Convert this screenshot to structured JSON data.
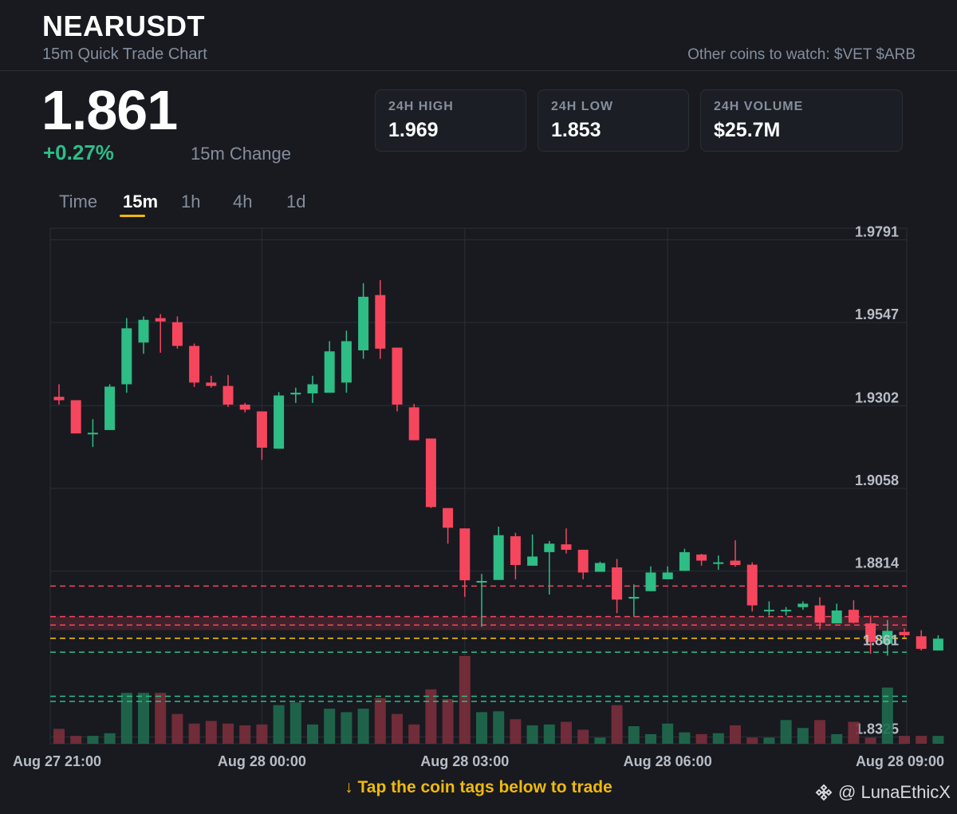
{
  "header": {
    "symbol": "NEARUSDT",
    "subtitle": "15m Quick Trade Chart",
    "watch_text": "Other coins to watch: $VET $ARB"
  },
  "price": {
    "last": "1.861",
    "change_pct": "+0.27%",
    "change_label": "15m Change"
  },
  "stats": [
    {
      "label": "24H HIGH",
      "value": "1.969"
    },
    {
      "label": "24H LOW",
      "value": "1.853"
    },
    {
      "label": "24H VOLUME",
      "value": "$25.7M"
    }
  ],
  "timeframes": {
    "items": [
      "Time",
      "15m",
      "1h",
      "4h",
      "1d"
    ],
    "active": "15m"
  },
  "chart_data": {
    "type": "candlestick",
    "y_ticks": [
      "1.9791",
      "1.9547",
      "1.9302",
      "1.9058",
      "1.8814",
      "1.8325"
    ],
    "ylim": [
      1.8305,
      1.9825
    ],
    "x_ticks": [
      "Aug 27 21:00",
      "Aug 28 00:00",
      "Aug 28 03:00",
      "Aug 28 06:00",
      "Aug 28 09:00"
    ],
    "x_tick_candle_index": [
      0,
      12,
      24,
      36,
      48
    ],
    "current_price_label": "1.861",
    "levels": [
      {
        "value": 1.877,
        "style": "dashed",
        "color": "#f6465d"
      },
      {
        "value": 1.868,
        "style": "dashed",
        "color": "#f6465d"
      },
      {
        "value": 1.8655,
        "style": "dashed",
        "color": "#f6465d"
      },
      {
        "value": 1.868,
        "style": "band",
        "color": "#f6465d",
        "band_to": 1.864
      },
      {
        "value": 1.8616,
        "style": "dashed",
        "color": "#f0b90b"
      },
      {
        "value": 1.8575,
        "style": "dashed",
        "color": "#2ebd85"
      },
      {
        "value": 1.8445,
        "style": "dashed",
        "color": "#2ebd85"
      },
      {
        "value": 1.843,
        "style": "dashed",
        "color": "#2ebd85"
      }
    ],
    "candles": [
      {
        "o": 1.9328,
        "h": 1.9365,
        "l": 1.9305,
        "c": 1.9318
      },
      {
        "o": 1.9318,
        "h": 1.9318,
        "l": 1.922,
        "c": 1.922
      },
      {
        "o": 1.9222,
        "h": 1.9262,
        "l": 1.918,
        "c": 1.9222
      },
      {
        "o": 1.923,
        "h": 1.9365,
        "l": 1.923,
        "c": 1.9358
      },
      {
        "o": 1.9365,
        "h": 1.956,
        "l": 1.934,
        "c": 1.953
      },
      {
        "o": 1.9488,
        "h": 1.9565,
        "l": 1.9455,
        "c": 1.9555
      },
      {
        "o": 1.956,
        "h": 1.9572,
        "l": 1.9458,
        "c": 1.955
      },
      {
        "o": 1.9548,
        "h": 1.9565,
        "l": 1.947,
        "c": 1.9478
      },
      {
        "o": 1.9478,
        "h": 1.9485,
        "l": 1.9357,
        "c": 1.937
      },
      {
        "o": 1.937,
        "h": 1.939,
        "l": 1.9355,
        "c": 1.936
      },
      {
        "o": 1.936,
        "h": 1.9392,
        "l": 1.9298,
        "c": 1.9305
      },
      {
        "o": 1.9305,
        "h": 1.931,
        "l": 1.9282,
        "c": 1.929
      },
      {
        "o": 1.9285,
        "h": 1.9285,
        "l": 1.9142,
        "c": 1.9178
      },
      {
        "o": 1.9175,
        "h": 1.9342,
        "l": 1.9175,
        "c": 1.9332
      },
      {
        "o": 1.9335,
        "h": 1.9355,
        "l": 1.931,
        "c": 1.934
      },
      {
        "o": 1.9338,
        "h": 1.939,
        "l": 1.931,
        "c": 1.9365
      },
      {
        "o": 1.934,
        "h": 1.9492,
        "l": 1.934,
        "c": 1.9462
      },
      {
        "o": 1.937,
        "h": 1.9523,
        "l": 1.934,
        "c": 1.9492
      },
      {
        "o": 1.9465,
        "h": 1.9663,
        "l": 1.944,
        "c": 1.9623
      },
      {
        "o": 1.9628,
        "h": 1.9672,
        "l": 1.944,
        "c": 1.947
      },
      {
        "o": 1.9473,
        "h": 1.9473,
        "l": 1.9285,
        "c": 1.9305
      },
      {
        "o": 1.9297,
        "h": 1.9307,
        "l": 1.92,
        "c": 1.92
      },
      {
        "o": 1.9205,
        "h": 1.9205,
        "l": 1.9,
        "c": 1.9003
      },
      {
        "o": 1.9,
        "h": 1.9,
        "l": 1.8895,
        "c": 1.8942
      },
      {
        "o": 1.894,
        "h": 1.894,
        "l": 1.8738,
        "c": 1.8787
      },
      {
        "o": 1.8782,
        "h": 1.8806,
        "l": 1.865,
        "c": 1.8785
      },
      {
        "o": 1.8788,
        "h": 1.8945,
        "l": 1.8788,
        "c": 1.892
      },
      {
        "o": 1.8917,
        "h": 1.8927,
        "l": 1.879,
        "c": 1.8832
      },
      {
        "o": 1.883,
        "h": 1.8922,
        "l": 1.883,
        "c": 1.8857
      },
      {
        "o": 1.887,
        "h": 1.8903,
        "l": 1.8745,
        "c": 1.8895
      },
      {
        "o": 1.8893,
        "h": 1.894,
        "l": 1.8866,
        "c": 1.8877
      },
      {
        "o": 1.8877,
        "h": 1.8877,
        "l": 1.879,
        "c": 1.881
      },
      {
        "o": 1.8812,
        "h": 1.8842,
        "l": 1.8812,
        "c": 1.8838
      },
      {
        "o": 1.8825,
        "h": 1.885,
        "l": 1.869,
        "c": 1.873
      },
      {
        "o": 1.8733,
        "h": 1.8775,
        "l": 1.868,
        "c": 1.8738
      },
      {
        "o": 1.8755,
        "h": 1.8828,
        "l": 1.8755,
        "c": 1.881
      },
      {
        "o": 1.879,
        "h": 1.8828,
        "l": 1.879,
        "c": 1.881
      },
      {
        "o": 1.8815,
        "h": 1.888,
        "l": 1.8815,
        "c": 1.887
      },
      {
        "o": 1.8863,
        "h": 1.8865,
        "l": 1.883,
        "c": 1.8845
      },
      {
        "o": 1.884,
        "h": 1.886,
        "l": 1.8818,
        "c": 1.884
      },
      {
        "o": 1.8845,
        "h": 1.8905,
        "l": 1.8827,
        "c": 1.8832
      },
      {
        "o": 1.8833,
        "h": 1.884,
        "l": 1.8695,
        "c": 1.8713
      },
      {
        "o": 1.8698,
        "h": 1.8725,
        "l": 1.8683,
        "c": 1.87
      },
      {
        "o": 1.8698,
        "h": 1.8708,
        "l": 1.8683,
        "c": 1.87
      },
      {
        "o": 1.8708,
        "h": 1.8725,
        "l": 1.87,
        "c": 1.8718
      },
      {
        "o": 1.8713,
        "h": 1.8737,
        "l": 1.8643,
        "c": 1.8662
      },
      {
        "o": 1.866,
        "h": 1.8718,
        "l": 1.866,
        "c": 1.8698
      },
      {
        "o": 1.87,
        "h": 1.8728,
        "l": 1.866,
        "c": 1.8662
      },
      {
        "o": 1.866,
        "h": 1.8683,
        "l": 1.857,
        "c": 1.8605
      },
      {
        "o": 1.86,
        "h": 1.867,
        "l": 1.8565,
        "c": 1.8638
      },
      {
        "o": 1.8635,
        "h": 1.8645,
        "l": 1.8618,
        "c": 1.8625
      },
      {
        "o": 1.8622,
        "h": 1.864,
        "l": 1.858,
        "c": 1.8585
      },
      {
        "o": 1.858,
        "h": 1.8625,
        "l": 1.858,
        "c": 1.8615
      }
    ],
    "volume_scale_max": 100,
    "volumes": [
      17,
      9,
      9,
      12,
      58,
      58,
      58,
      34,
      23,
      26,
      23,
      21,
      22,
      44,
      47,
      22,
      40,
      36,
      40,
      52,
      34,
      22,
      62,
      51,
      100,
      36,
      37,
      28,
      21,
      22,
      25,
      16,
      7,
      44,
      20,
      11,
      23,
      13,
      11,
      12,
      21,
      7,
      7,
      27,
      18,
      27,
      11,
      25,
      7,
      64,
      9,
      9,
      9
    ]
  },
  "footer": {
    "cta": "↓ Tap the coin tags below to trade",
    "brand": "@ LunaEthicX"
  },
  "colors": {
    "up": "#2ebd85",
    "down": "#f6465d",
    "accent": "#f0b90b",
    "grid": "#2b2f36",
    "background": "#181a20"
  }
}
